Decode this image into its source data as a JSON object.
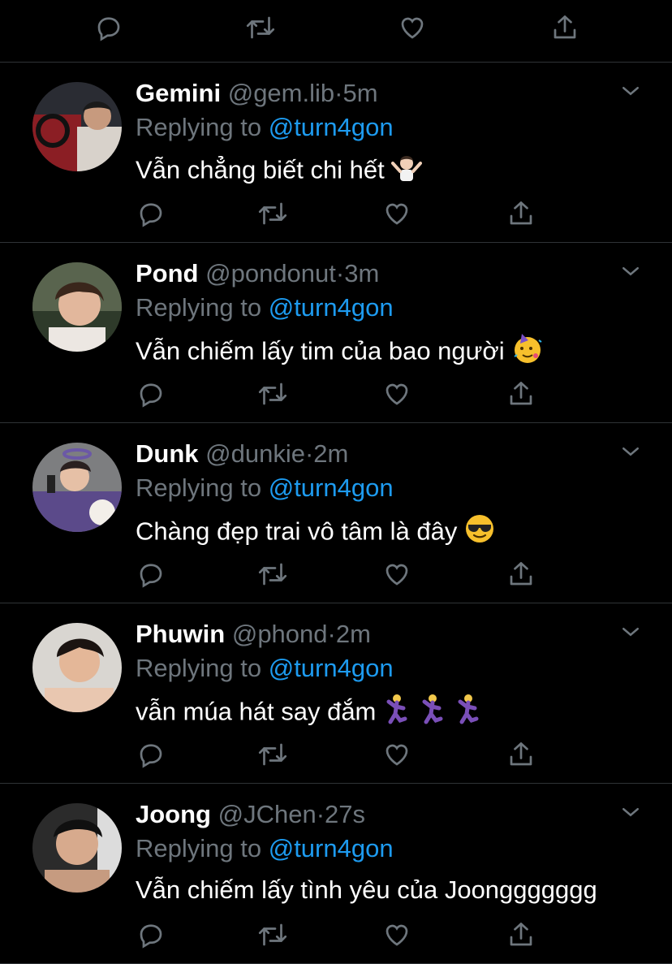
{
  "actions_icons": [
    "reply-icon",
    "retweet-icon",
    "like-icon",
    "share-icon"
  ],
  "colors": {
    "background": "#000000",
    "divider": "#2f3336",
    "muted": "#6e767d",
    "link": "#1d9bf0"
  },
  "replying_label": "Replying to",
  "replying_mention": "@turn4gon",
  "tweets": [
    {
      "name": "Gemini",
      "handle": "@gem.lib",
      "time": "5m",
      "text": "Vẫn chẳng biết chi hết",
      "emoji": [
        "person-shrugging"
      ]
    },
    {
      "name": "Pond",
      "handle": "@pondonut",
      "time": "3m",
      "text": "Vẫn chiếm lấy tim của bao người",
      "emoji": [
        "partying-face"
      ]
    },
    {
      "name": "Dunk",
      "handle": "@dunkie",
      "time": "2m",
      "text": "Chàng đẹp trai vô tâm là đây",
      "emoji": [
        "smiling-face-with-sunglasses"
      ]
    },
    {
      "name": "Phuwin",
      "handle": "@phond",
      "time": "2m",
      "text": "vẫn múa hát say đắm",
      "emoji": [
        "man-dancing",
        "man-dancing",
        "man-dancing"
      ]
    },
    {
      "name": "Joong",
      "handle": "@JChen",
      "time": "27s",
      "text": "Vẫn chiếm lấy tình yêu của Joonggggggg",
      "emoji": []
    }
  ]
}
